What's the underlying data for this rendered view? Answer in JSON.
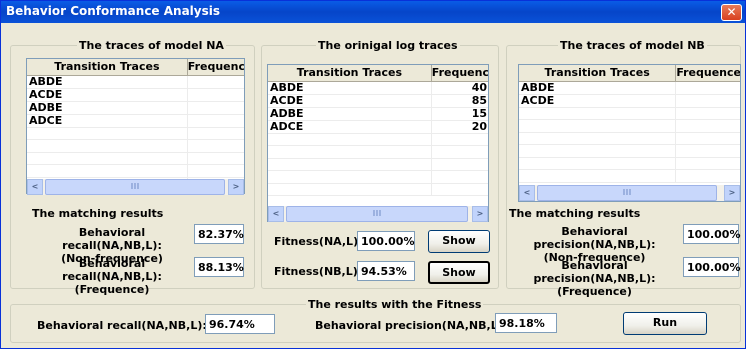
{
  "window": {
    "title": "Behavior Conformance Analysis",
    "close_glyph": "✕"
  },
  "group_na": {
    "legend": "The traces of model NA",
    "columns": [
      "Transition Traces",
      "Frequenc"
    ],
    "rows": [
      [
        "ABDE",
        ""
      ],
      [
        "ACDE",
        ""
      ],
      [
        "ADBE",
        ""
      ],
      [
        "ADCE",
        ""
      ],
      [
        "",
        ""
      ],
      [
        "",
        ""
      ],
      [
        "",
        ""
      ],
      [
        "",
        ""
      ],
      [
        "",
        ""
      ]
    ],
    "matching_label": "The matching results",
    "recall_nonfreq_label": "Behavioral recall(NA,NB,L):\n(Non-frequence)",
    "recall_nonfreq_value": "82.37%",
    "recall_freq_label": "Behavioral recall(NA,NB,L):\n(Frequence)",
    "recall_freq_value": "88.13%"
  },
  "group_log": {
    "legend": "The orinigal log traces",
    "columns": [
      "Transition Traces",
      "Frequenc"
    ],
    "rows": [
      [
        "ABDE",
        "40"
      ],
      [
        "ACDE",
        "85"
      ],
      [
        "ADBE",
        "15"
      ],
      [
        "ADCE",
        "20"
      ],
      [
        "",
        ""
      ],
      [
        "",
        ""
      ],
      [
        "",
        ""
      ],
      [
        "",
        ""
      ],
      [
        "",
        ""
      ]
    ],
    "fitness_na_label": "Fitness(NA,L):",
    "fitness_na_value": "100.00%",
    "fitness_nb_label": "Fitness(NB,L):",
    "fitness_nb_value": "94.53%",
    "show_label": "Show"
  },
  "group_nb": {
    "legend": "The traces of model NB",
    "columns": [
      "Transition Traces",
      "Frequence"
    ],
    "rows": [
      [
        "ABDE",
        ""
      ],
      [
        "ACDE",
        ""
      ],
      [
        "",
        ""
      ],
      [
        "",
        ""
      ],
      [
        "",
        ""
      ],
      [
        "",
        ""
      ],
      [
        "",
        ""
      ],
      [
        "",
        ""
      ]
    ],
    "matching_label": "The matching results",
    "prec_nonfreq_label": "Behavioral precision(NA,NB,L):\n(Non-frequence)",
    "prec_nonfreq_value": "100.00%",
    "prec_freq_label": "Behavioral precision(NA,NB,L):\n(Frequence)",
    "prec_freq_value": "100.00%"
  },
  "group_fitness": {
    "legend": "The results with the Fitness",
    "recall_label": "Behavioral recall(NA,NB,L):",
    "recall_value": "96.74%",
    "precision_label": "Behavioral precision(NA,NB,L):",
    "precision_value": "98.18%",
    "run_label": "Run"
  },
  "scroll": {
    "left_arrow": "<",
    "right_arrow": ">",
    "thumb_grip": "III"
  }
}
